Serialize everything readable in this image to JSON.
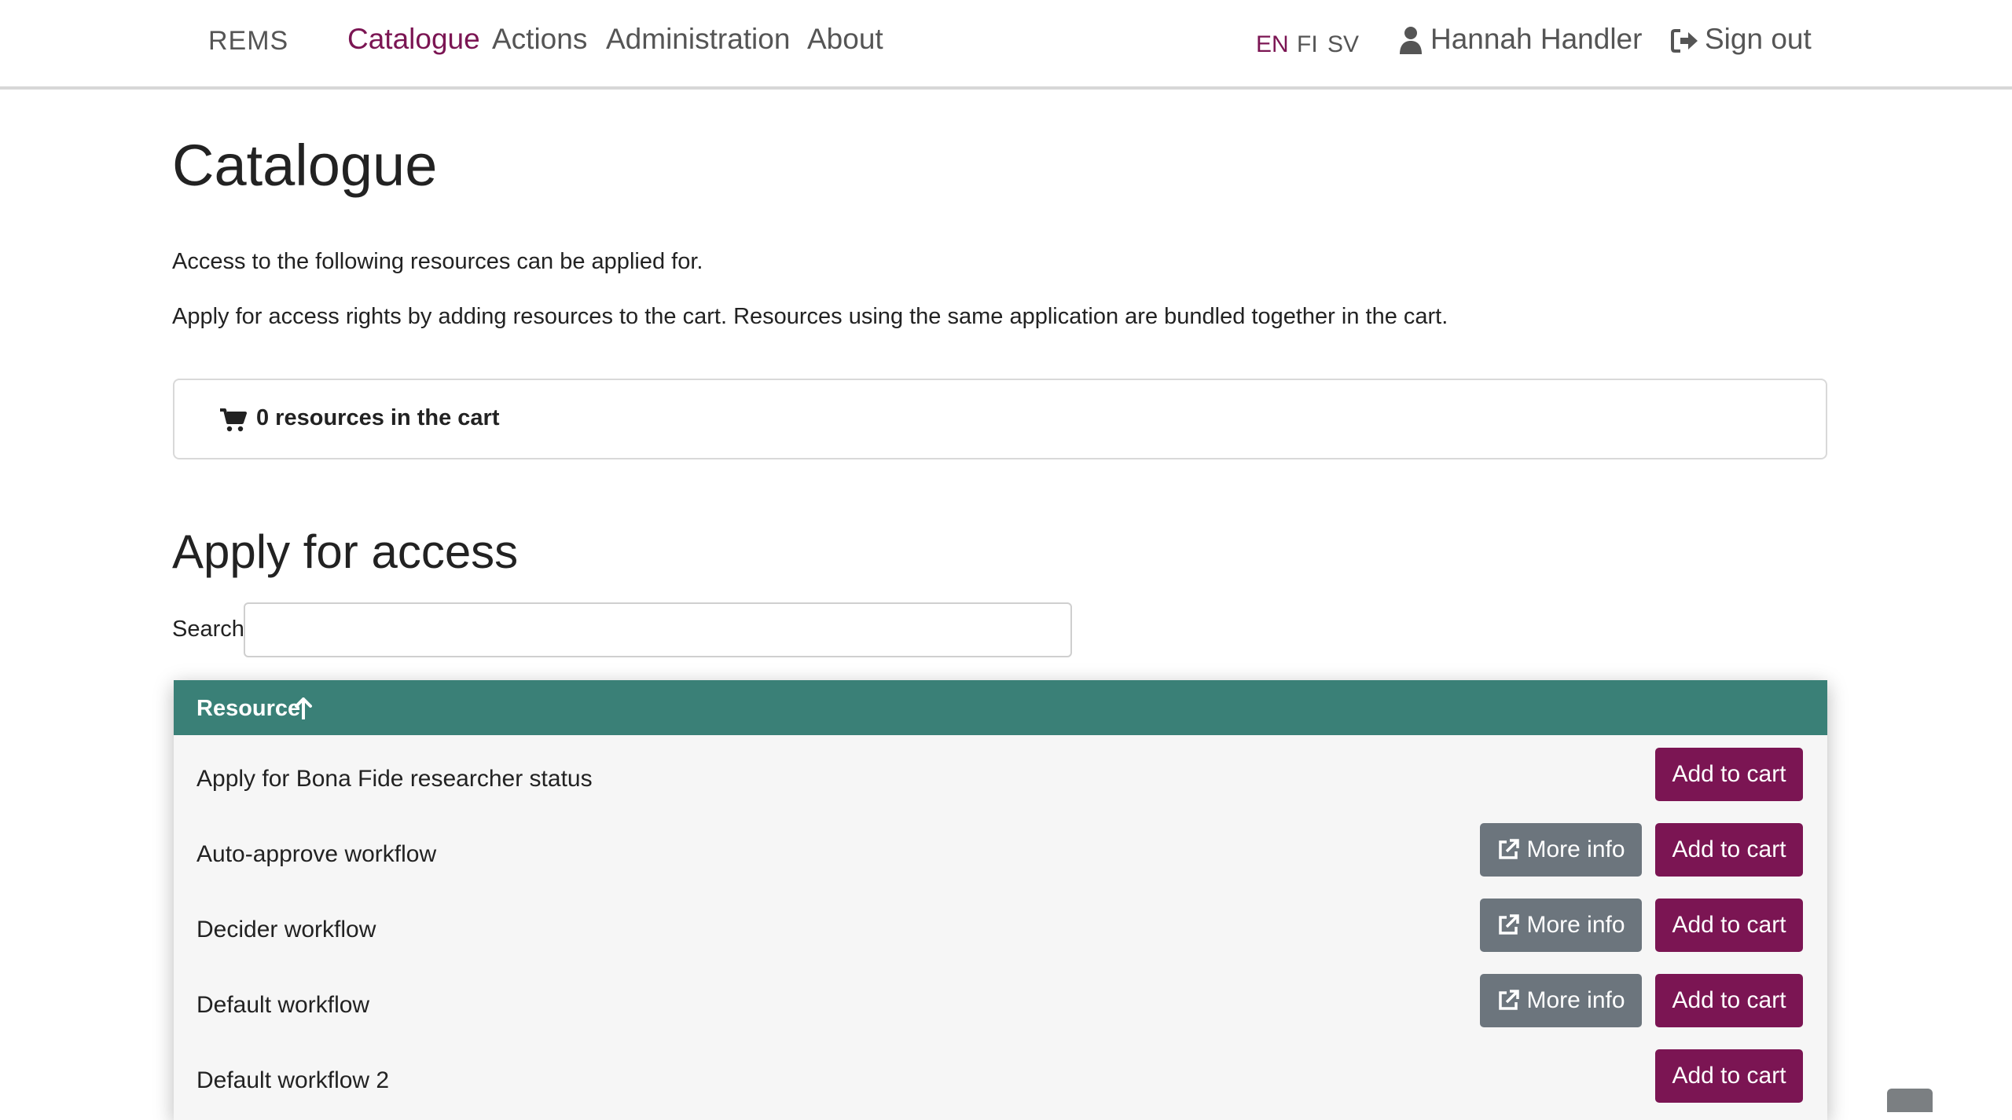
{
  "navbar": {
    "brand": "REMS",
    "links": [
      {
        "label": "Catalogue",
        "active": true
      },
      {
        "label": "Actions",
        "active": false
      },
      {
        "label": "Administration",
        "active": false
      },
      {
        "label": "About",
        "active": false
      }
    ],
    "languages": [
      {
        "code": "EN",
        "active": true
      },
      {
        "code": "FI",
        "active": false
      },
      {
        "code": "SV",
        "active": false
      }
    ],
    "user_name": "Hannah Handler",
    "user_icon": "user-icon",
    "sign_out_label": "Sign out",
    "sign_out_icon": "sign-out-icon"
  },
  "page": {
    "title": "Catalogue",
    "intro_1": "Access to the following resources can be applied for.",
    "intro_2": "Apply for access rights by adding resources to the cart. Resources using the same application are bundled together in the cart."
  },
  "cart": {
    "icon": "shopping-cart-icon",
    "summary": "0 resources in the cart"
  },
  "apply": {
    "title": "Apply for access",
    "search_label": "Search",
    "search_value": "",
    "table": {
      "column_header": "Resource",
      "sort_icon": "arrow-up-icon",
      "rows": [
        {
          "title": "Apply for Bona Fide researcher status",
          "more_info": false,
          "more_info_label": "",
          "add_label": "Add to cart"
        },
        {
          "title": "Auto-approve workflow",
          "more_info": true,
          "more_info_label": "More info",
          "add_label": "Add to cart"
        },
        {
          "title": "Decider workflow",
          "more_info": true,
          "more_info_label": "More info",
          "add_label": "Add to cart"
        },
        {
          "title": "Default workflow",
          "more_info": true,
          "more_info_label": "More info",
          "add_label": "Add to cart"
        },
        {
          "title": "Default workflow 2",
          "more_info": false,
          "more_info_label": "",
          "add_label": "Add to cart"
        }
      ]
    }
  },
  "colors": {
    "accent": "#7b1553",
    "table_header": "#3a8077",
    "secondary_button": "#6c757d"
  }
}
